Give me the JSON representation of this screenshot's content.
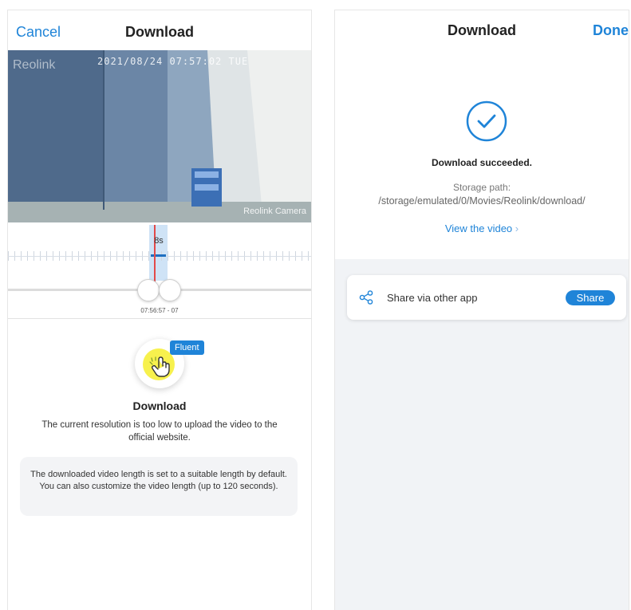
{
  "left_panel": {
    "cancel_label": "Cancel",
    "title": "Download",
    "camera": {
      "brand_watermark": "Reolink",
      "timestamp": "2021/08/24 07:57:02 TUE",
      "camera_name": "Reolink Camera"
    },
    "timeline": {
      "duration": "8s",
      "time_label": "07:56:57 - 07"
    },
    "badge": "Fluent",
    "download_title": "Download",
    "download_desc": "The current resolution is too low to upload the video to the official website.",
    "note": "The downloaded video length is set to a suitable length by default. You can also customize the video length (up to 120 seconds)."
  },
  "right_panel": {
    "title": "Download",
    "done_label": "Done",
    "success_message": "Download succeeded.",
    "storage_label": "Storage path:",
    "storage_path": "/storage/emulated/0/Movies/Reolink/download/",
    "view_link": "View the video",
    "share_label": "Share via other app",
    "share_button": "Share"
  },
  "colors": {
    "accent": "#1f84d8",
    "background": "#f1f3f6"
  },
  "icons": {
    "success": "check-circle-icon",
    "share": "share-icon",
    "view_chevron": "chevron-right-icon",
    "download": "hand-pointer-icon"
  }
}
